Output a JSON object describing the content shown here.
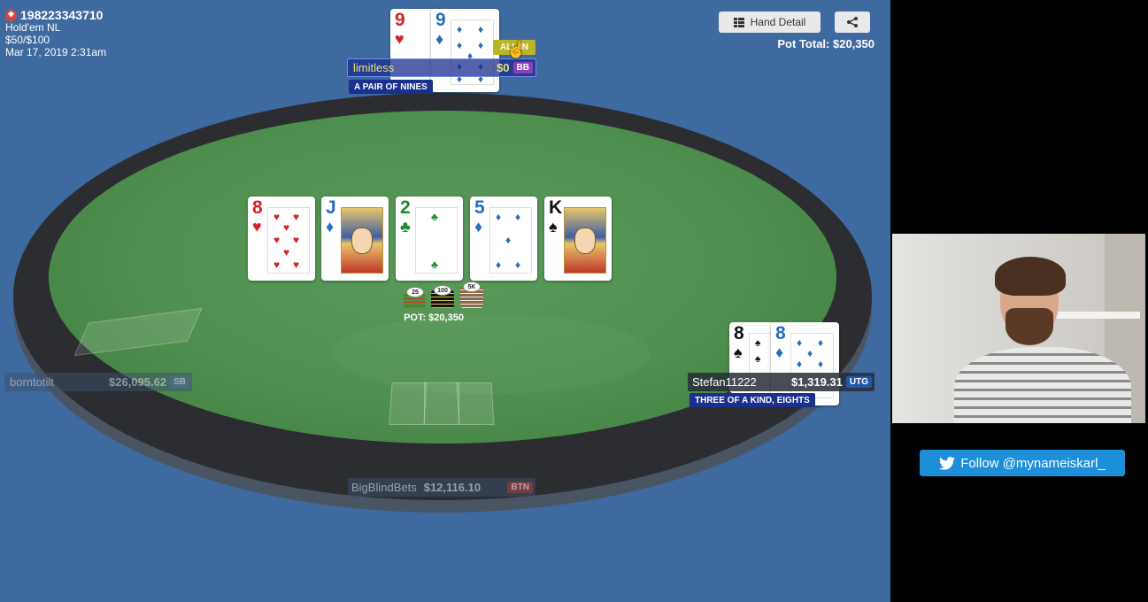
{
  "hand": {
    "id": "198223343710",
    "game": "Hold'em NL",
    "stakes": "$50/$100",
    "date": "Mar 17, 2019  2:31am"
  },
  "toolbar": {
    "hand_detail_label": "Hand Detail"
  },
  "pot_total": {
    "label": "Pot Total:",
    "value": "$20,350"
  },
  "board": [
    {
      "rank": "8",
      "suit": "♥",
      "color": "#d3232a"
    },
    {
      "rank": "J",
      "suit": "♦",
      "color": "#2a6dbd"
    },
    {
      "rank": "2",
      "suit": "♣",
      "color": "#1e8a2b"
    },
    {
      "rank": "5",
      "suit": "♦",
      "color": "#2a6dbd"
    },
    {
      "rank": "K",
      "suit": "♠",
      "color": "#111111"
    }
  ],
  "pot": {
    "label": "POT: $20,350",
    "chips": [
      "25",
      "100",
      "5K"
    ]
  },
  "players": {
    "top": {
      "name": "limitless",
      "stack": "$0",
      "position": "BB",
      "status": "ALL IN",
      "result": "A PAIR OF NINES",
      "cards": [
        {
          "rank": "9",
          "suit": "♥",
          "color": "#d3232a"
        },
        {
          "rank": "9",
          "suit": "♦",
          "color": "#2a6dbd"
        }
      ]
    },
    "right": {
      "name": "Stefan11222",
      "stack": "$1,319.31",
      "position": "UTG",
      "result": "THREE OF A KIND, EIGHTS",
      "cards": [
        {
          "rank": "8",
          "suit": "♠",
          "color": "#111111"
        },
        {
          "rank": "8",
          "suit": "♦",
          "color": "#2a6dbd"
        }
      ]
    },
    "left": {
      "name": "borntotilt",
      "stack": "$26,095.62",
      "position": "SB"
    },
    "bottom": {
      "name": "BigBlindBets",
      "stack": "$12,116.10",
      "position": "BTN"
    }
  },
  "follow": {
    "label": "Follow @mynameiskarl_"
  },
  "colors": {
    "table_bg": "#3f6aa0",
    "felt": "#4f8f4f",
    "result_badge": "#1b2f8c",
    "bb_badge": "#8e3fb5",
    "utg_badge": "#2158a8",
    "allin_badge": "#b8b528",
    "twitter": "#1d8ed8"
  }
}
